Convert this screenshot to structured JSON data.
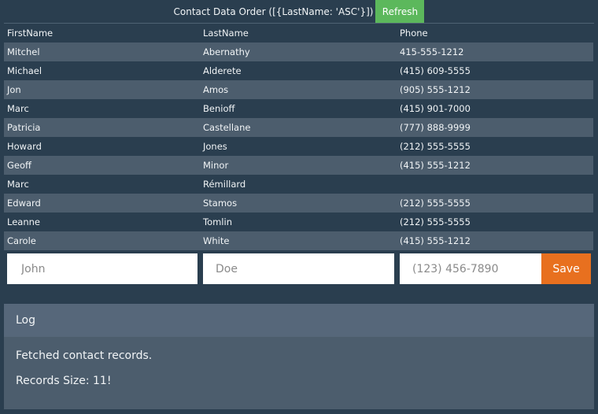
{
  "header": {
    "title": "Contact Data Order ([{LastName: 'ASC'}])",
    "refresh_label": "Refresh"
  },
  "table": {
    "columns": [
      "FirstName",
      "LastName",
      "Phone"
    ],
    "rows": [
      [
        "Mitchel",
        "Abernathy",
        "415-555-1212"
      ],
      [
        "Michael",
        "Alderete",
        "(415) 609-5555"
      ],
      [
        "Jon",
        "Amos",
        "(905) 555-1212"
      ],
      [
        "Marc",
        "Benioff",
        "(415) 901-7000"
      ],
      [
        "Patricia",
        "Castellane",
        "(777) 888-9999"
      ],
      [
        "Howard",
        "Jones",
        "(212) 555-5555"
      ],
      [
        "Geoff",
        "Minor",
        "(415) 555-1212"
      ],
      [
        "Marc",
        "Rémillard",
        ""
      ],
      [
        "Edward",
        "Stamos",
        "(212) 555-5555"
      ],
      [
        "Leanne",
        "Tomlin",
        "(212) 555-5555"
      ],
      [
        "Carole",
        "White",
        "(415) 555-1212"
      ]
    ]
  },
  "form": {
    "first_placeholder": "John",
    "last_placeholder": "Doe",
    "phone_placeholder": "(123) 456-7890",
    "save_label": "Save"
  },
  "log": {
    "heading": "Log",
    "lines": [
      "Fetched contact records.",
      "Records Size: 11!"
    ]
  },
  "colors": {
    "background": "#2a3e4f",
    "row_alt": "#4c5d6d",
    "refresh_button": "#5cb85c",
    "save_button": "#e8701f"
  }
}
